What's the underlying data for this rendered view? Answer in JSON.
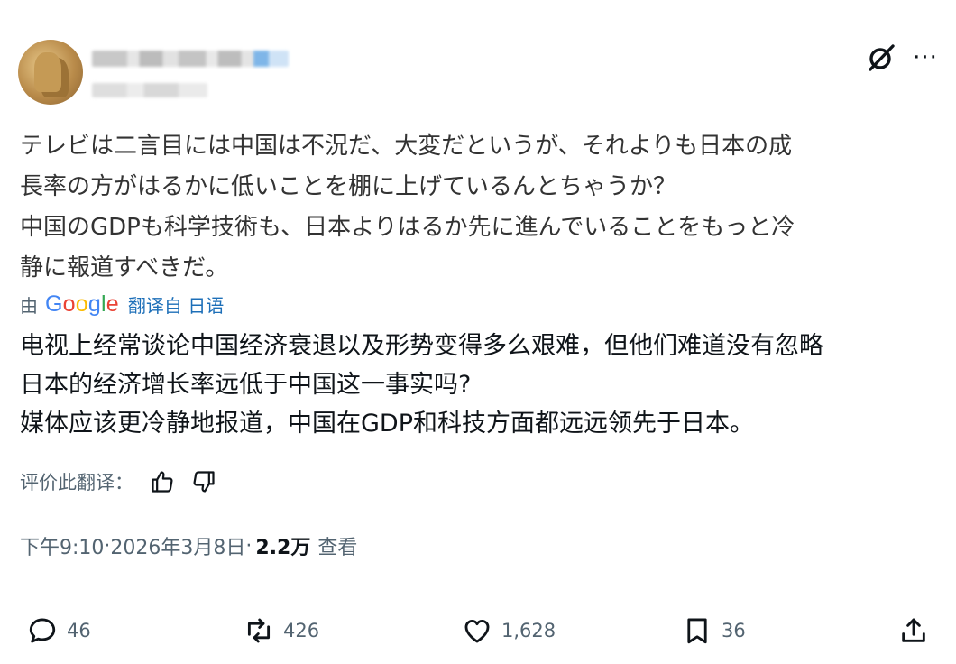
{
  "header": {
    "avatar_desc": "user-avatar",
    "grok_icon": "grok-icon",
    "more_label": "···"
  },
  "post": {
    "original_text": [
      "テレビは二言目には中国は不況だ、大変だというが、それよりも日本の成",
      "長率の方がはるかに低いことを棚に上げているんとちゃうか？",
      "中国のGDPも科学技術も、日本よりはるか先に進んでいることをもっと冷",
      "静に報道すべきだ。"
    ],
    "translated_by_prefix": "由",
    "google_logo": "Google",
    "translated_from": "翻译自 日语",
    "translated_text": [
      "电视上经常谈论中国经济衰退以及形势变得多么艰难，但他们难道没有忽略",
      "日本的经济增长率远低于中国这一事实吗?",
      "媒体应该更冷静地报道，中国在GDP和科技方面都远远领先于日本。"
    ],
    "rate_label": "评价此翻译：",
    "time": "下午9:10",
    "separator": " · ",
    "date": "2026年3月8日",
    "separator2": " · ",
    "views_count": "2.2万",
    "views_label": "查看"
  },
  "actions": {
    "reply_count": "46",
    "repost_count": "426",
    "like_count": "1,628",
    "bookmark_count": "36"
  },
  "colors": {
    "text_primary": "#0f1419",
    "text_secondary": "#536471",
    "link_blue": "#1d6fb8"
  }
}
